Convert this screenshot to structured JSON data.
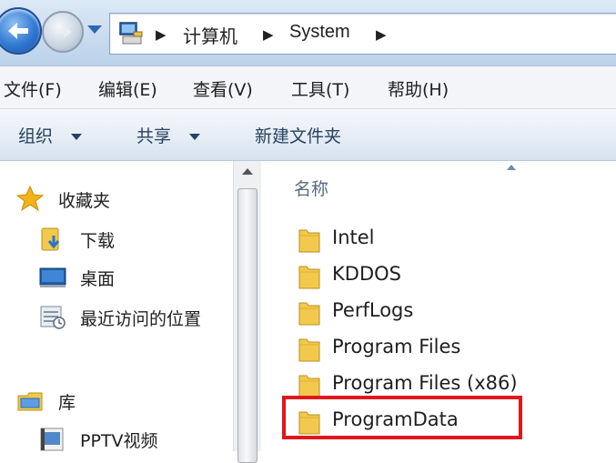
{
  "address_bar": {
    "crumbs": [
      "计算机",
      "System"
    ]
  },
  "menu": {
    "items": [
      "文件(F)",
      "编辑(E)",
      "查看(V)",
      "工具(T)",
      "帮助(H)"
    ]
  },
  "toolbar": {
    "organize": "组织",
    "share": "共享",
    "new_folder": "新建文件夹"
  },
  "nav_pane": {
    "favorites_header": "收藏夹",
    "favorites": [
      "下载",
      "桌面",
      "最近访问的位置"
    ],
    "libraries_header": "库",
    "libraries": [
      "PPTV视频"
    ]
  },
  "file_list": {
    "column_header": "名称",
    "items": [
      "Intel",
      "KDDOS",
      "PerfLogs",
      "Program Files",
      "Program Files (x86)",
      "ProgramData"
    ],
    "highlighted": "ProgramData"
  },
  "colors": {
    "highlight_border": "#e0171c",
    "folder_yellow": "#f2c94c"
  }
}
